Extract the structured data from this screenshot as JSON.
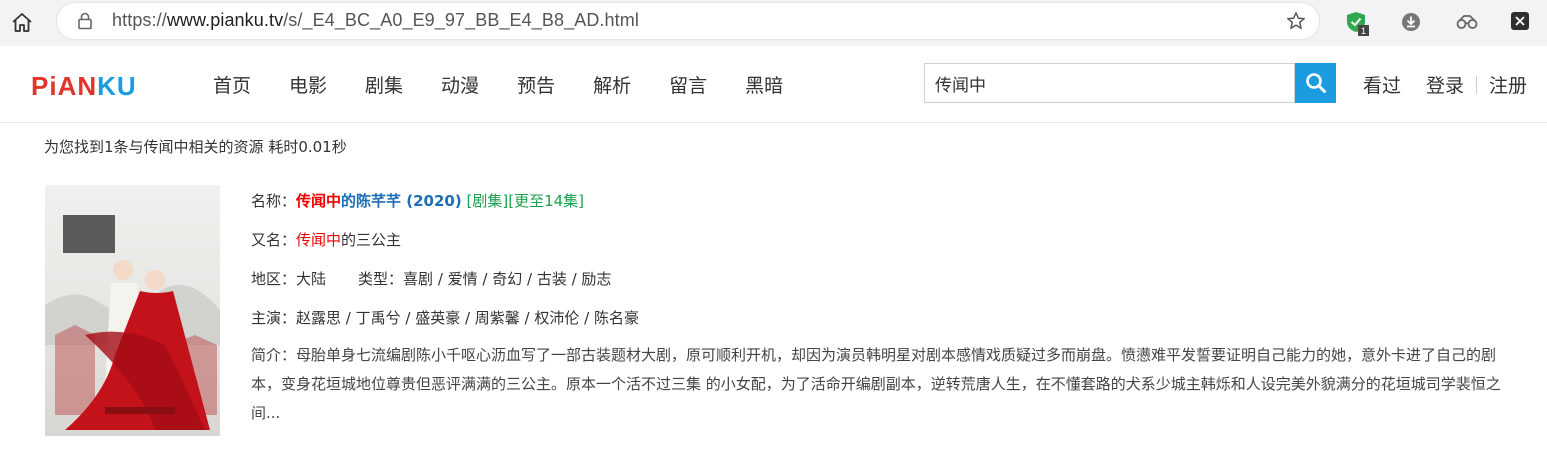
{
  "browser": {
    "url_scheme": "https://",
    "url_host": "www.pianku.tv",
    "url_path": "/s/_E4_BC_A0_E9_97_BB_E4_B8_AD.html",
    "extension_badge": "1"
  },
  "site": {
    "logo_part1": "PiAN",
    "logo_part2": "KU",
    "nav": [
      "首页",
      "电影",
      "剧集",
      "动漫",
      "预告",
      "解析",
      "留言",
      "黑暗"
    ],
    "search_value": "传闻中",
    "user_actions": {
      "watched": "看过",
      "login": "登录",
      "register": "注册"
    }
  },
  "results": {
    "summary": "为您找到1条与传闻中相关的资源 耗时0.01秒",
    "item": {
      "name_label": "名称：",
      "name_highlight": "传闻中",
      "name_rest": "的陈芊芊 (2020)",
      "tag_type": "[剧集]",
      "tag_update": "[更至14集]",
      "alias_label": "又名：",
      "alias_highlight": "传闻中",
      "alias_rest": "的三公主",
      "region_label": "地区：",
      "region": "大陆",
      "genre_label": "类型：",
      "genre": "喜剧 / 爱情 / 奇幻 / 古装 / 励志",
      "cast_label": "主演：",
      "cast": "赵露思 / 丁禹兮 / 盛英豪 / 周紫馨 / 权沛伦 / 陈名豪",
      "intro_label": "简介：",
      "intro": "母胎单身七流编剧陈小千呕心沥血写了一部古装题材大剧，原可顺利开机，却因为演员韩明星对剧本感情戏质疑过多而崩盘。愤懑难平发誓要证明自己能力的她，意外卡进了自己的剧本，变身花垣城地位尊贵但恶评满满的三公主。原本一个活不过三集 的小女配，为了活命开编剧副本，逆转荒唐人生，在不懂套路的犬系少城主韩烁和人设完美外貌满分的花垣城司学裴恒之间..."
    }
  }
}
